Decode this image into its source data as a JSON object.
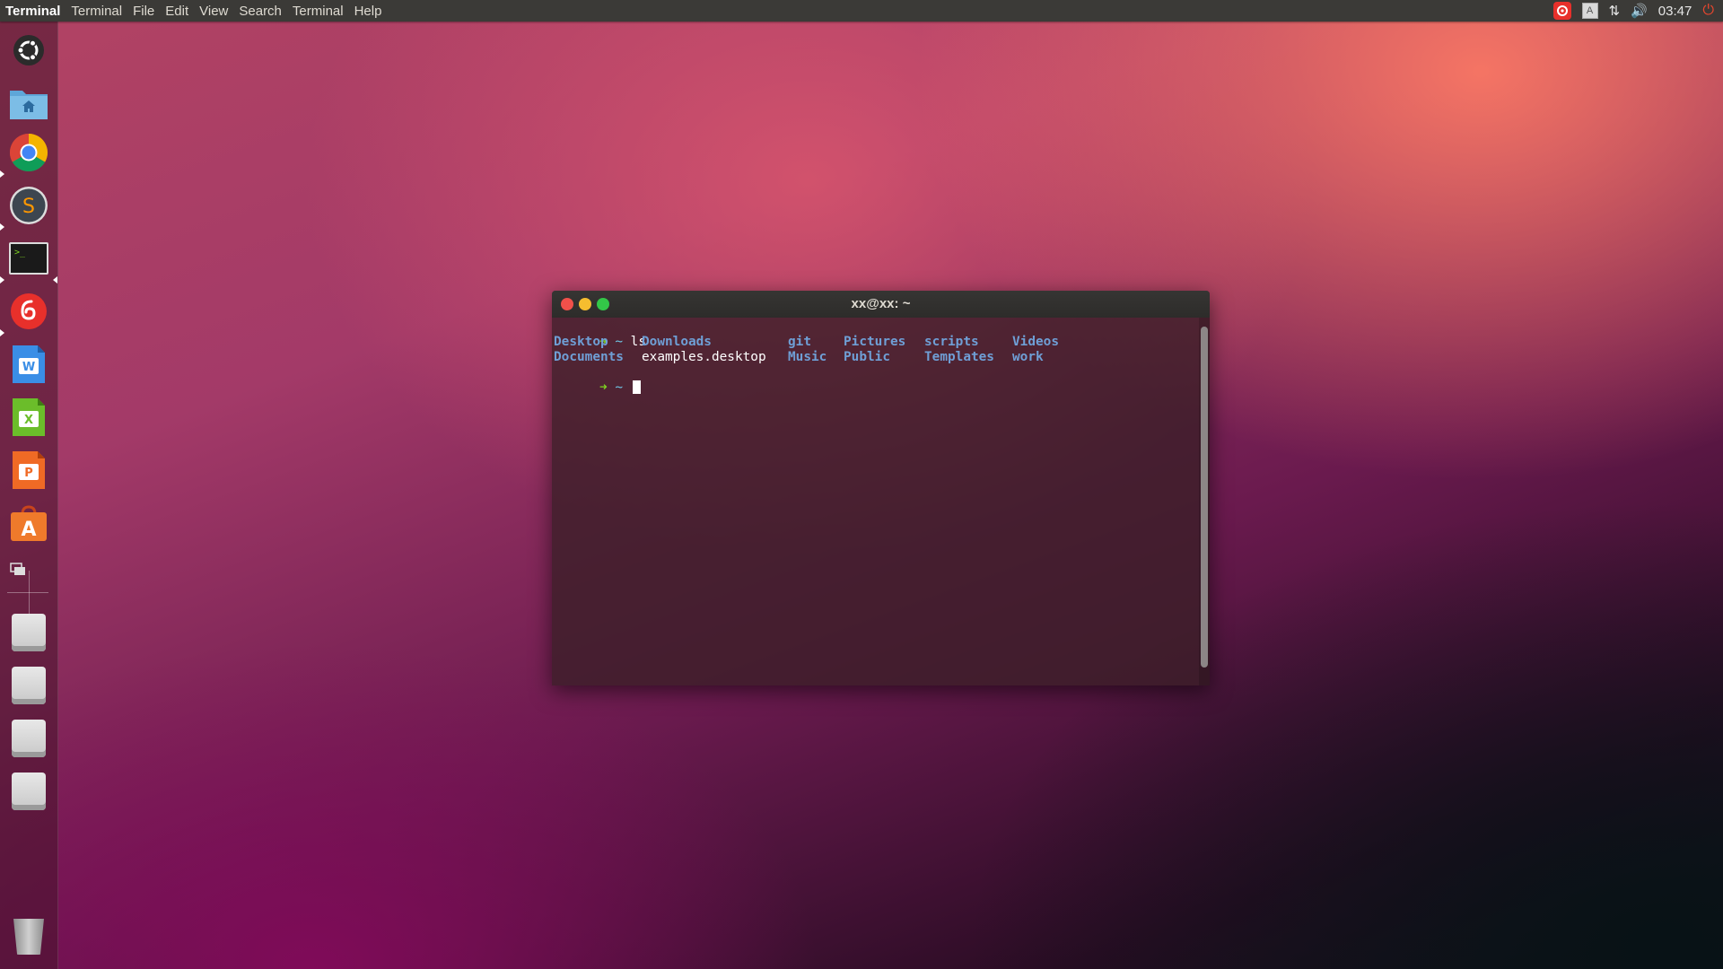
{
  "top_panel": {
    "app_title": "Terminal",
    "menu": [
      "Terminal",
      "File",
      "Edit",
      "View",
      "Search",
      "Terminal",
      "Help"
    ],
    "indicators": {
      "keyboard": "A",
      "network": "⇅",
      "volume": "🔊",
      "clock": "03:47",
      "power": "⏻"
    }
  },
  "launcher": {
    "items": [
      {
        "name": "ubuntu-dash",
        "icon": "ubuntu-logo-icon"
      },
      {
        "name": "files",
        "icon": "home-folder-icon"
      },
      {
        "name": "chrome",
        "icon": "chrome-icon"
      },
      {
        "name": "sublime",
        "icon": "sublime-text-icon",
        "glyph": "S"
      },
      {
        "name": "terminal",
        "icon": "terminal-icon",
        "glyph": ">_"
      },
      {
        "name": "netease-music",
        "icon": "netease-music-icon"
      },
      {
        "name": "wps-writer",
        "icon": "wps-writer-icon",
        "glyph": "W"
      },
      {
        "name": "wps-spreadsheet",
        "icon": "wps-spreadsheet-icon",
        "glyph": "X"
      },
      {
        "name": "wps-presentation",
        "icon": "wps-presentation-icon",
        "glyph": "P"
      },
      {
        "name": "software-center",
        "icon": "software-center-icon",
        "glyph": "A"
      },
      {
        "name": "workspace-switcher",
        "icon": "workspace-switcher-icon"
      },
      {
        "name": "drive-1",
        "icon": "drive-icon"
      },
      {
        "name": "drive-2",
        "icon": "drive-icon"
      },
      {
        "name": "drive-3",
        "icon": "drive-icon"
      },
      {
        "name": "drive-4",
        "icon": "drive-icon"
      },
      {
        "name": "trash",
        "icon": "trash-icon"
      }
    ]
  },
  "terminal": {
    "title": "xx@xx: ~",
    "prompt_arrow": "➜",
    "prompt_dir": "~",
    "command": "ls",
    "listing_row1": [
      "Desktop",
      "Downloads",
      "git",
      "Pictures",
      "scripts",
      "Videos"
    ],
    "listing_row2": [
      "Documents",
      "examples.desktop",
      "Music",
      "Public",
      "Templates",
      "work"
    ]
  }
}
